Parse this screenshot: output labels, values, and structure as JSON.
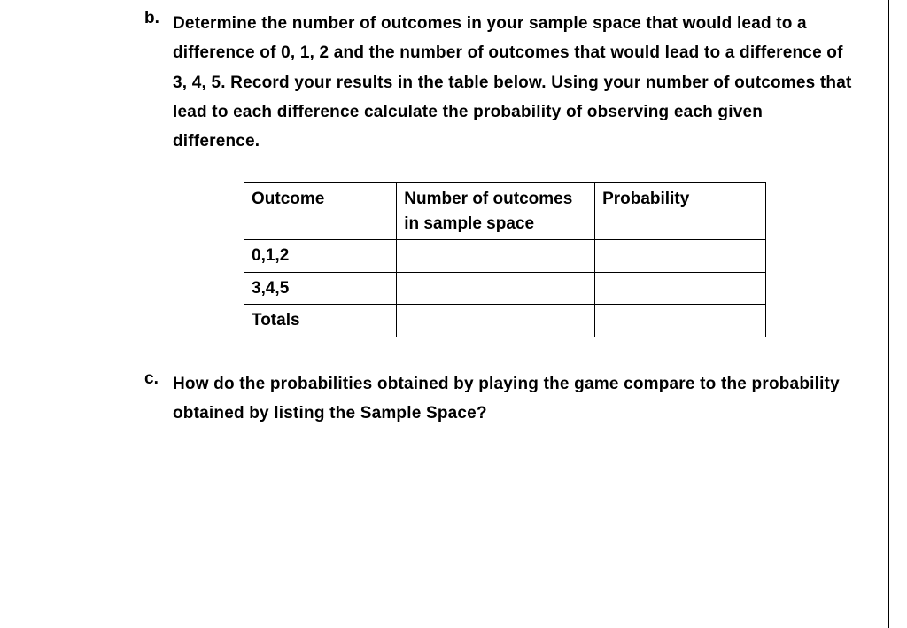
{
  "items": {
    "b": {
      "label": "b.",
      "text": "Determine the number of outcomes in your sample space that would lead to a difference of 0, 1, 2 and the number of outcomes that would lead to a difference of 3, 4, 5. Record your results in the table below. Using your number of outcomes that lead to each difference calculate the probability of observing each given difference."
    },
    "c": {
      "label": "c.",
      "text": "How do the probabilities obtained by playing the game compare to the probability obtained by listing the Sample Space?"
    }
  },
  "table": {
    "headers": {
      "col0": "Outcome",
      "col1": "Number of outcomes in sample space",
      "col2": "Probability"
    },
    "rows": {
      "r0": {
        "c0": "0,1,2",
        "c1": "",
        "c2": ""
      },
      "r1": {
        "c0": "3,4,5",
        "c1": "",
        "c2": ""
      },
      "r2": {
        "c0": "Totals",
        "c1": "",
        "c2": ""
      }
    }
  }
}
